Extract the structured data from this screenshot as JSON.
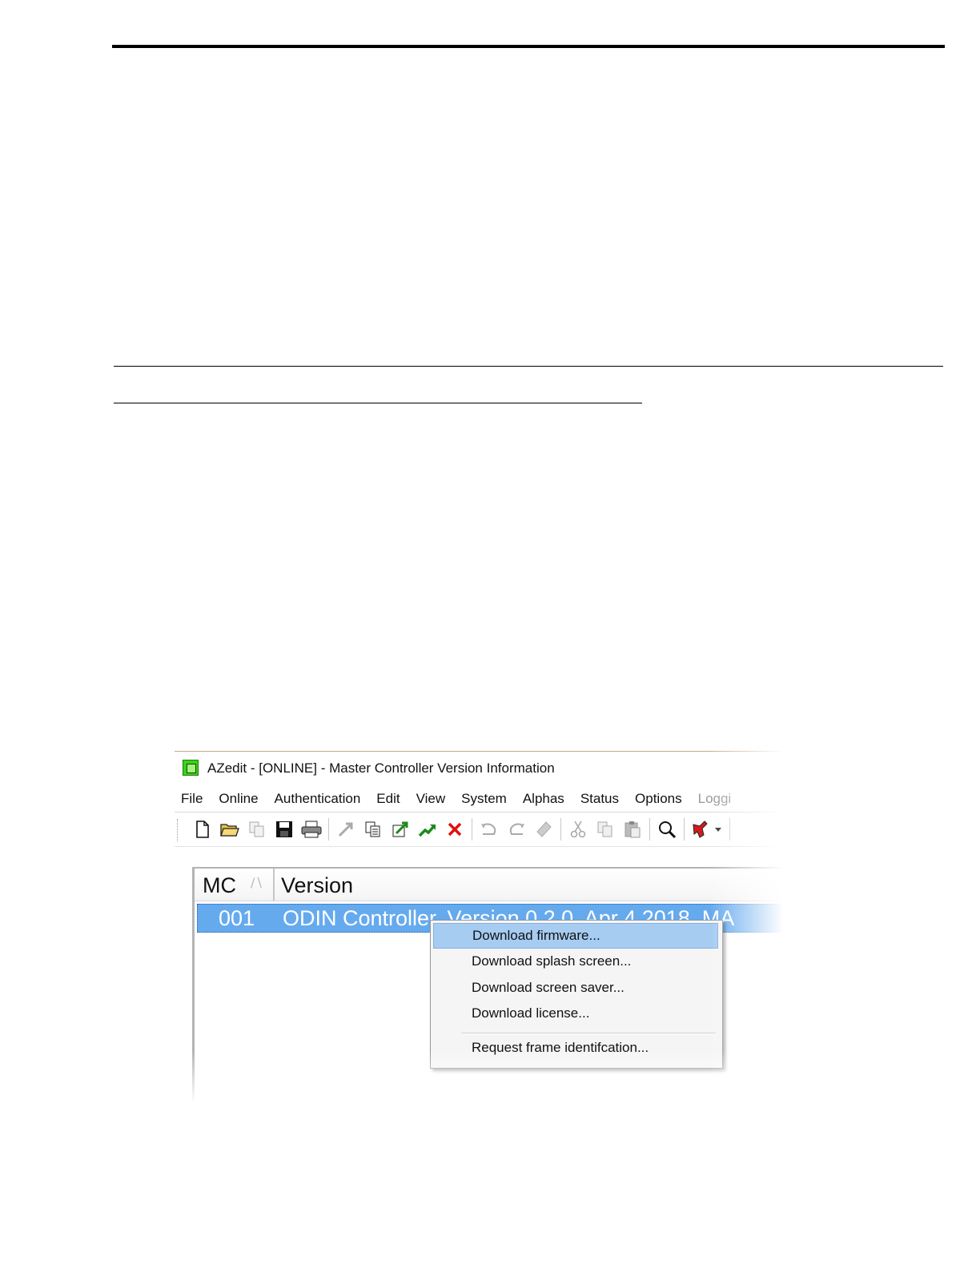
{
  "window": {
    "title": "AZedit - [ONLINE] - Master Controller Version Information"
  },
  "menubar": {
    "items": [
      "File",
      "Online",
      "Authentication",
      "Edit",
      "View",
      "System",
      "Alphas",
      "Status",
      "Options",
      "Loggi"
    ]
  },
  "toolbar": {
    "icons": [
      "new-icon",
      "open-icon",
      "copy-doc-icon",
      "save-icon",
      "print-icon",
      "upload-icon",
      "transfer-icon",
      "export-icon",
      "forward-icon",
      "delete-icon",
      "undo-icon",
      "redo-icon",
      "eraser-icon",
      "cut-icon",
      "copy-icon",
      "paste-icon",
      "find-icon",
      "tools-icon"
    ]
  },
  "list": {
    "columns": [
      "MC",
      "Version"
    ],
    "rows": [
      {
        "mc": "001",
        "version": "ODIN Controller, Version 0.2.0, Apr 4 2018, MA"
      }
    ]
  },
  "context_menu": {
    "items": [
      "Download firmware...",
      "Download splash screen...",
      "Download screen saver...",
      "Download license...",
      "Request frame identifcation..."
    ]
  },
  "colors": {
    "selection": "#66aaee",
    "menu_hover": "#a6ccf2",
    "app_icon": "#3bd11a"
  }
}
